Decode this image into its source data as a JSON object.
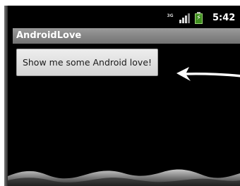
{
  "status_bar": {
    "network_label": "3G",
    "signal_icon": "signal-bars-icon",
    "battery_icon": "battery-charging-icon",
    "time": "5:42"
  },
  "app": {
    "title": "AndroidLove"
  },
  "main": {
    "button_label": "Show me some Android love!"
  },
  "annotation": {
    "arrow_icon": "pointing-arrow-icon"
  },
  "colors": {
    "background": "#000000",
    "title_bar": "#8a8a8a",
    "button": "#e3e3e3",
    "battery": "#3f8f1f"
  }
}
